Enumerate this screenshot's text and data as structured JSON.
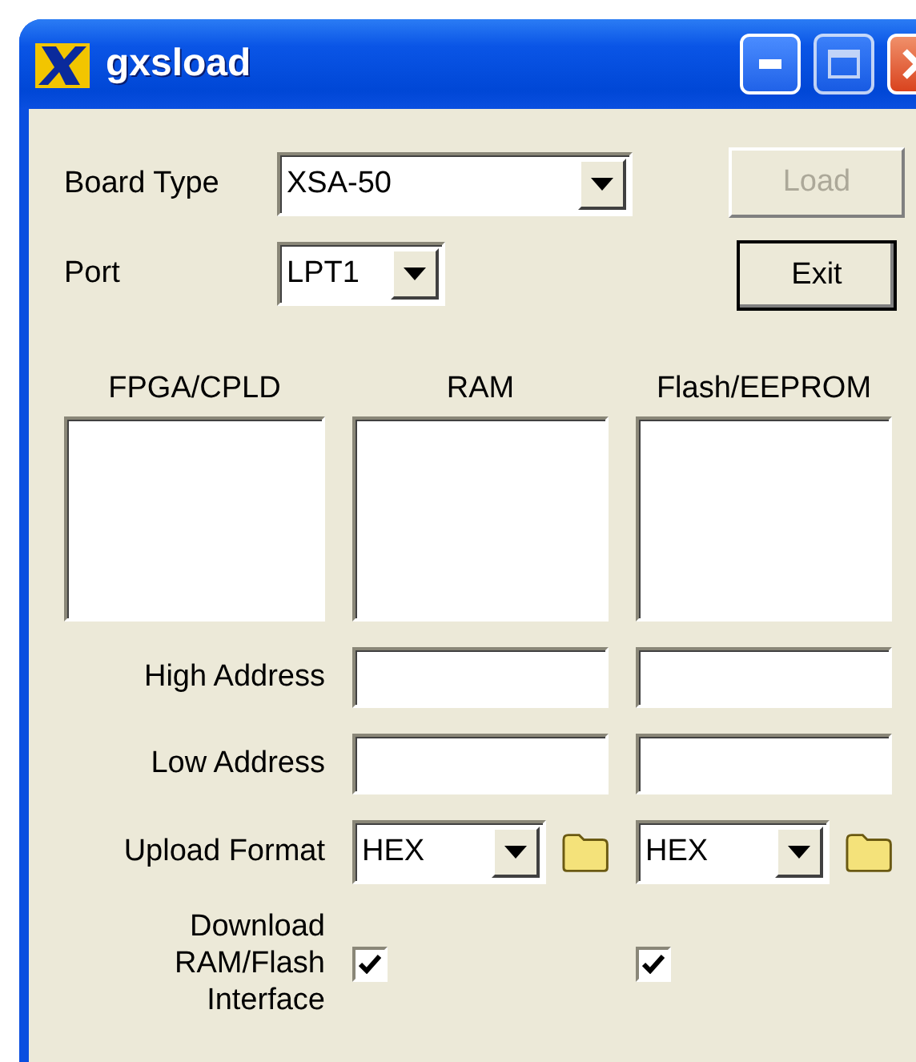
{
  "window": {
    "title": "gxsload"
  },
  "board_type": {
    "label": "Board Type",
    "value": "XSA-50"
  },
  "port": {
    "label": "Port",
    "value": "LPT1"
  },
  "buttons": [
    {
      "label": "Load",
      "disabled": true,
      "default": false
    },
    {
      "label": "Exit",
      "disabled": false,
      "default": true
    }
  ],
  "columns": [
    {
      "heading": "FPGA/CPLD"
    },
    {
      "heading": "RAM"
    },
    {
      "heading": "Flash/EEPROM"
    }
  ],
  "high_address": {
    "label": "High Address"
  },
  "low_address": {
    "label": "Low Address"
  },
  "upload_format": {
    "label": "Upload Format",
    "values": [
      "HEX",
      "HEX"
    ]
  },
  "download_interface": {
    "label": "Download\nRAM/Flash\nInterface",
    "checked": [
      true,
      true
    ]
  }
}
